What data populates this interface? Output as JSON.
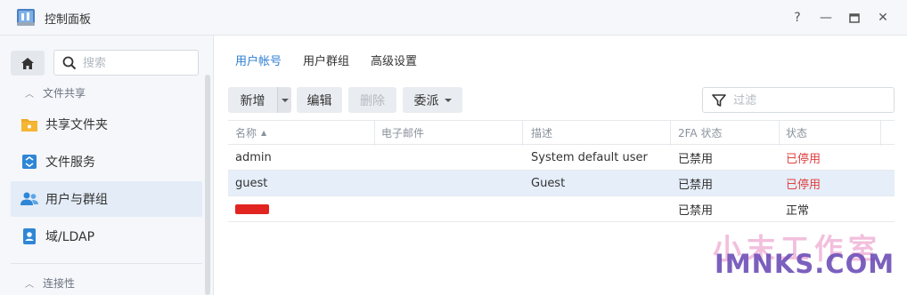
{
  "window": {
    "title": "控制面板",
    "controls": {
      "help": "?",
      "minimize": "—",
      "maximize": "▣",
      "close": "✕"
    }
  },
  "sidebar": {
    "search_placeholder": "搜索",
    "sections": [
      {
        "label": "文件共享",
        "chevron": "︿"
      },
      {
        "label": "连接性",
        "chevron": "︿"
      }
    ],
    "items": [
      {
        "label": "共享文件夹",
        "icon": "folder-share-icon"
      },
      {
        "label": "文件服务",
        "icon": "file-service-icon"
      },
      {
        "label": "用户与群组",
        "icon": "users-icon",
        "active": true
      },
      {
        "label": "域/LDAP",
        "icon": "ldap-icon"
      }
    ]
  },
  "tabs": [
    {
      "label": "用户帐号",
      "active": true
    },
    {
      "label": "用户群组"
    },
    {
      "label": "高级设置"
    }
  ],
  "toolbar": {
    "create": "新增",
    "edit": "编辑",
    "delete": "删除",
    "delegate": "委派",
    "filter_placeholder": "过滤"
  },
  "table": {
    "columns": [
      "名称",
      "电子邮件",
      "描述",
      "2FA 状态",
      "状态"
    ],
    "rows": [
      {
        "name": "admin",
        "email": "",
        "description": "System default user",
        "twofa": "已禁用",
        "status": "已停用"
      },
      {
        "name": "guest",
        "email": "",
        "description": "Guest",
        "twofa": "已禁用",
        "status": "已停用",
        "selected": true
      },
      {
        "name": "",
        "email": "",
        "description": "",
        "twofa": "已禁用",
        "status": "正常",
        "redacted": true
      }
    ]
  },
  "watermark": {
    "cn": "小末工作室",
    "en": "IMNKS.COM"
  },
  "colors": {
    "accent": "#2f7fd3",
    "disabled_status": "#e0403f",
    "selected_row": "#e5eef9"
  }
}
